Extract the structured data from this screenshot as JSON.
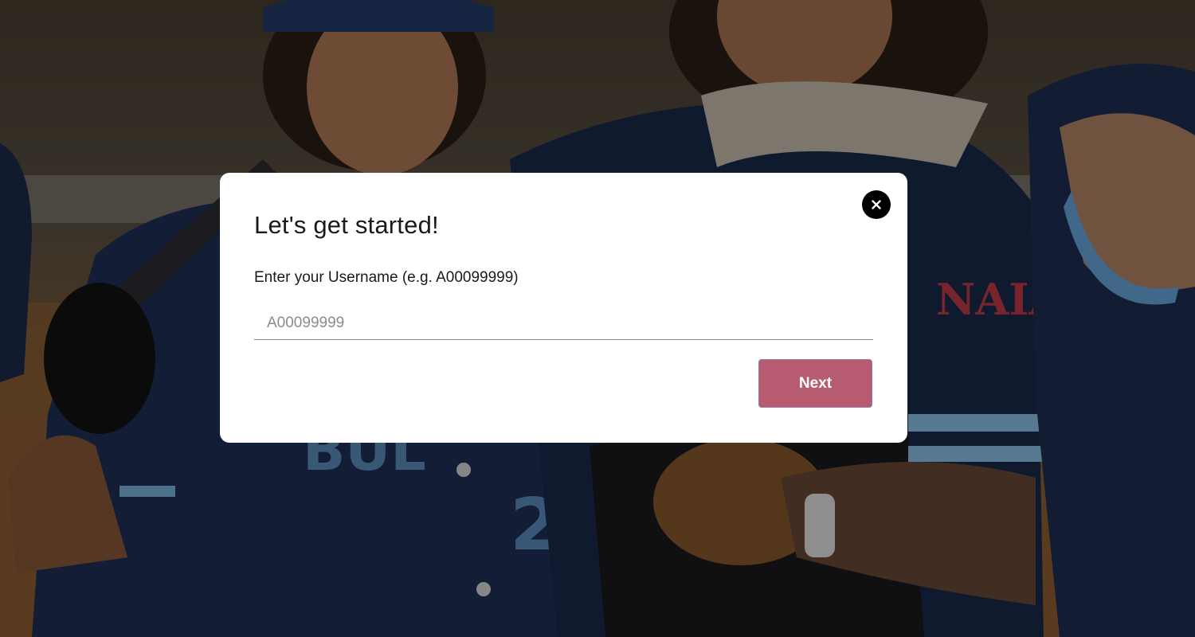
{
  "modal": {
    "title": "Let's get started!",
    "close_icon": "close-icon",
    "username_label": "Enter your Username (e.g. A00099999)",
    "username_placeholder": "A00099999",
    "username_value": "",
    "next_label": "Next"
  },
  "background": {
    "description_icon": "photo-background",
    "jersey_text": "NAIA"
  },
  "colors": {
    "next_button": "#b65b70",
    "close_button": "#000000",
    "modal_background": "#ffffff"
  }
}
